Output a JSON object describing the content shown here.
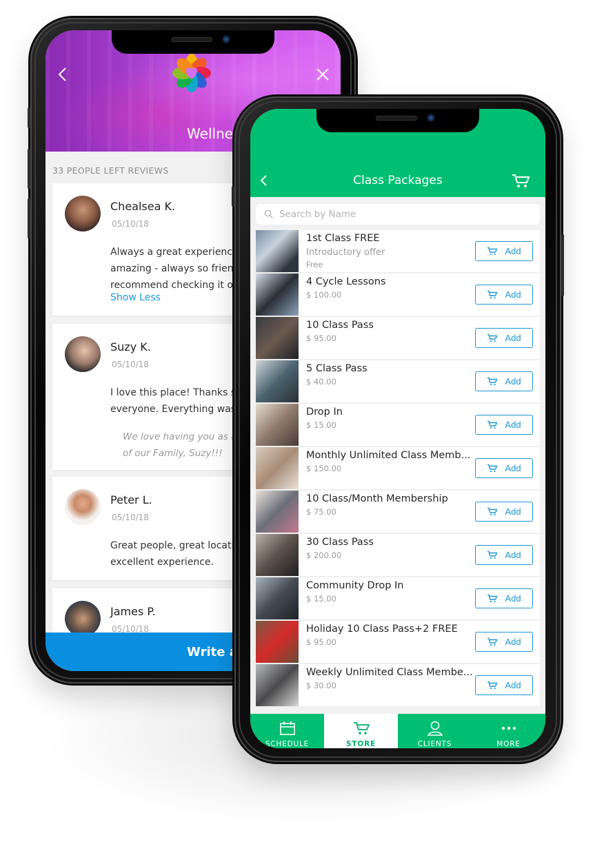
{
  "reviews_screen": {
    "studio_name": "Wellness Studio",
    "reviews_count_label": "33 PEOPLE LEFT REVIEWS",
    "reviews": [
      {
        "name": "Chealsea K.",
        "date": "05/10/18",
        "text_lines": [
          "Always a great experience",
          "amazing - always so friend",
          "recommend checking it ou"
        ],
        "toggle_label": "Show Less"
      },
      {
        "name": "Suzy K.",
        "date": "05/10/18",
        "text_lines": [
          "I love this place! Thanks so",
          "everyone. Everything was"
        ],
        "reply_lines": [
          "We love having you as a p",
          "of our Family, Suzy!!!"
        ]
      },
      {
        "name": "Peter L.",
        "date": "05/10/18",
        "text_lines": [
          "Great people, great locatio",
          "excellent experience."
        ]
      },
      {
        "name": "James P.",
        "date": "05/10/18"
      }
    ],
    "write_review_label": "Write a review"
  },
  "store_screen": {
    "title": "Class Packages",
    "search_placeholder": "Search by Name",
    "add_label": "Add",
    "packages": [
      {
        "name": "1st Class FREE",
        "subtitle": "Introductory offer",
        "price": "Free"
      },
      {
        "name": "4 Cycle Lessons",
        "price": "$ 100.00"
      },
      {
        "name": "10 Class Pass",
        "price": "$ 95.00"
      },
      {
        "name": "5 Class Pass",
        "price": "$ 40.00"
      },
      {
        "name": "Drop In",
        "price": "$ 15.00"
      },
      {
        "name": "Monthly Unlimited Class Memb...",
        "price": "$ 150.00"
      },
      {
        "name": "10 Class/Month Membership",
        "price": "$ 75.00"
      },
      {
        "name": "30 Class Pass",
        "price": "$ 200.00"
      },
      {
        "name": "Community Drop In",
        "price": "$ 15.00"
      },
      {
        "name": "Holiday 10 Class Pass+2 FREE",
        "price": "$ 95.00"
      },
      {
        "name": "Weekly Unlimited Class Membe...",
        "price": "$ 30.00"
      }
    ],
    "tabs": [
      {
        "label": "SCHEDULE",
        "icon": "calendar-icon",
        "active": false
      },
      {
        "label": "STORE",
        "icon": "cart-icon",
        "active": true
      },
      {
        "label": "CLIENTS",
        "icon": "person-icon",
        "active": false
      },
      {
        "label": "MORE",
        "icon": "more-icon",
        "active": false
      }
    ]
  },
  "colors": {
    "store_green": "#00bf72",
    "review_purple": "#b848de",
    "link_blue": "#1a9be0",
    "write_review_blue": "#0a8fe0",
    "add_button_blue": "#1c97d4"
  }
}
